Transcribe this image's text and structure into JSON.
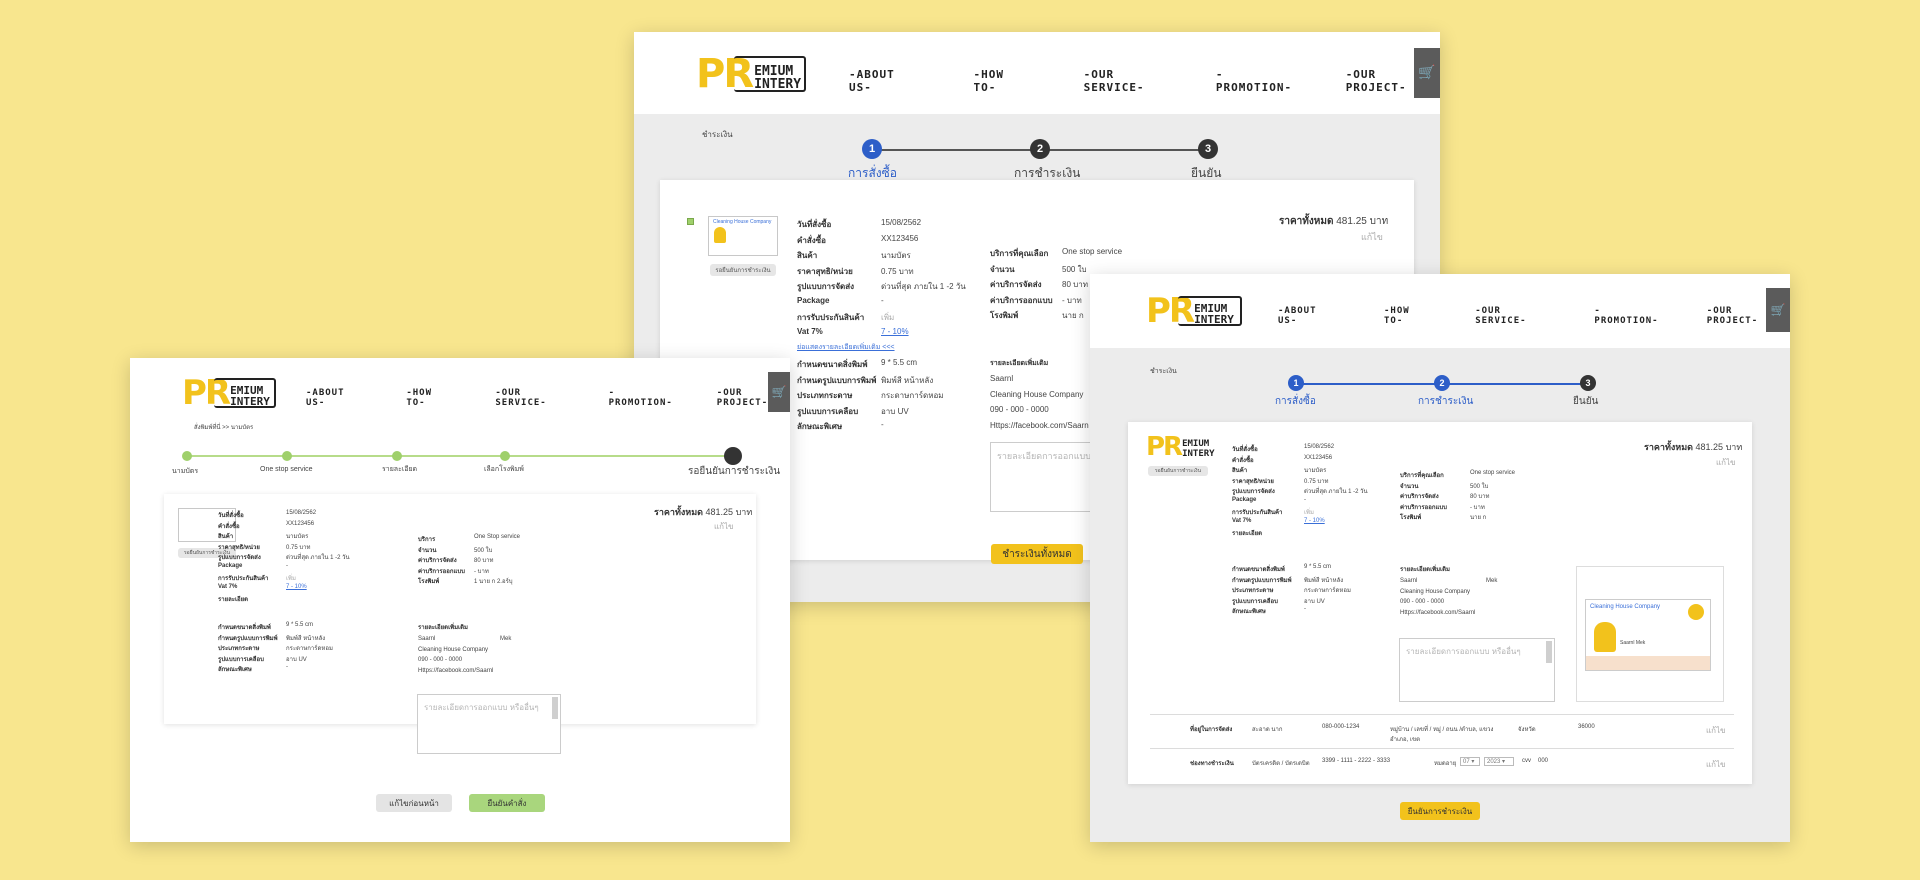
{
  "brand": {
    "logo_pr": "PR",
    "logo_top": "EMIUM",
    "logo_bottom": "INTERY"
  },
  "nav": [
    "-ABOUT US-",
    "-HOW TO-",
    "-OUR SERVICE-",
    "-PROMOTION-",
    "-OUR PROJECT-"
  ],
  "icons": {
    "cart": "shopping-cart-icon"
  },
  "colors": {
    "bg": "#f8e68e",
    "brand_yellow": "#f2c21c",
    "step_blue": "#2d5ec8",
    "green": "#9fd06b"
  },
  "center": {
    "breadcrumb": "ชำระเงิน",
    "steps": [
      "การสั่งซื้อ",
      "การชำระเงิน",
      "ยืนยัน"
    ],
    "step_nums": [
      "1",
      "2",
      "3"
    ],
    "status_btn": "รอยืนยันการชำระเงิน",
    "total_label": "ราคาทั้งหมด",
    "total_value": "481.25",
    "total_unit": "บาท",
    "edit": "แก้ไข",
    "left_rows": [
      {
        "label": "วันที่สั่งซื้อ",
        "value": "15/08/2562"
      },
      {
        "label": "คำสั่งซื้อ",
        "value": "XX123456"
      },
      {
        "label": "สินค้า",
        "value": "นามบัตร"
      },
      {
        "label": "ราคาสุทธิ/หน่วย",
        "value": "0.75 บาท"
      },
      {
        "label": "รูปแบบการจัดส่ง",
        "value": "ด่วนที่สุด ภายใน 1 -2 วัน"
      },
      {
        "label": "Package",
        "value": "-"
      },
      {
        "label": "การรับประกันสินค้า",
        "value": "เพิ่ม"
      },
      {
        "label": "Vat 7%",
        "value": "7 - 10%"
      }
    ],
    "right_rows": [
      {
        "label": "บริการที่คุณเลือก",
        "value": "One stop service"
      },
      {
        "label": "จำนวน",
        "value": "500 ใบ"
      },
      {
        "label": "ค่าบริการจัดส่ง",
        "value": "80 บาท"
      },
      {
        "label": "ค่าบริการออกแบบ",
        "value": "- บาท"
      },
      {
        "label": "โรงพิมพ์",
        "value": "นาย ก"
      }
    ],
    "more_link": "ย่อแสดงรายละเอียดเพิ่มเติม <<<",
    "spec_rows": [
      {
        "label": "กำหนดขนาดสิ่งพิมพ์",
        "value": "9 * 5.5 cm"
      },
      {
        "label": "กำหนดรูปแบบการพิมพ์",
        "value": "พิมพ์สี หน้าหลัง"
      },
      {
        "label": "ประเภทกระดาษ",
        "value": "กระดาษการ์ดหอม"
      },
      {
        "label": "รูปแบบการเคลือบ",
        "value": "อาบ UV"
      },
      {
        "label": "ลักษณะพิเศษ",
        "value": "-"
      }
    ],
    "extra_title": "รายละเอียดเพิ่มเติม",
    "extra_lines": [
      "Saarnl",
      "Cleaning House Company",
      "090 - 000 - 0000",
      "Https://facebook.com/Saarn"
    ],
    "textarea_ph": "รายละเอียดการออกแบบ",
    "pay_btn": "ชำระเงินทั้งหมด"
  },
  "left": {
    "breadcrumb": "สั่งพิมพ์ที่นี่ >> นามบัตร",
    "progress": [
      "นามบัตร",
      "One stop service",
      "รายละเอียด",
      "เลือกโรงพิมพ์",
      "รอยืนยันการชำระเงิน"
    ],
    "status_btn": "รอยืนยันการชำระเงิน",
    "total_label": "ราคาทั้งหมด",
    "total_value": "481.25",
    "total_unit": "บาท",
    "edit": "แก้ไข",
    "left_rows": [
      {
        "label": "วันที่สั่งซื้อ",
        "value": "15/08/2562"
      },
      {
        "label": "คำสั่งซื้อ",
        "value": "XX123456"
      },
      {
        "label": "สินค้า",
        "value": "นามบัตร"
      },
      {
        "label": "ราคาสุทธิ/หน่วย",
        "value": "0.75 บาท"
      },
      {
        "label": "รูปแบบการจัดส่ง",
        "value": "ด่วนที่สุด ภายใน 1 -2 วัน"
      },
      {
        "label": "Package",
        "value": "-"
      },
      {
        "label": "การรับประกันสินค้า",
        "value": "เพิ่ม"
      },
      {
        "label": "Vat 7%",
        "value": "7 - 10%"
      },
      {
        "label": "รายละเอียด",
        "value": ""
      }
    ],
    "right_rows": [
      {
        "label": "บริการ",
        "value": "One Stop service"
      },
      {
        "label": "จำนวน",
        "value": "500 ใบ"
      },
      {
        "label": "ค่าบริการจัดส่ง",
        "value": "80 บาท"
      },
      {
        "label": "ค่าบริการออกแบบ",
        "value": "- บาท"
      },
      {
        "label": "โรงพิมพ์",
        "value": "1 นาย ก  2.อร์บุ"
      }
    ],
    "spec_rows": [
      {
        "label": "กำหนดขนาดสิ่งพิมพ์",
        "value": "9 * 5.5 cm"
      },
      {
        "label": "กำหนดรูปแบบการพิมพ์",
        "value": "พิมพ์สี หน้าหลัง"
      },
      {
        "label": "ประเภทกระดาษ",
        "value": "กระดาษการ์ดหอม"
      },
      {
        "label": "รูปแบบการเคลือบ",
        "value": "อาบ UV"
      },
      {
        "label": "ลักษณะพิเศษ",
        "value": "-"
      }
    ],
    "extra_title": "รายละเอียดเพิ่มเติม",
    "extra_lines": [
      "Saarnl",
      "Cleaning House Company",
      "090 - 000 - 0000",
      "Https://facebook.com/Saarnl"
    ],
    "extra_side": "Mek",
    "textarea_ph": "รายละเอียดการออกแบบ หรืออื่นๆ",
    "back_btn": "แก้ไขก่อนหน้า",
    "confirm_btn": "ยืนยันคำสั่ง"
  },
  "right": {
    "breadcrumb": "ชำระเงิน",
    "steps": [
      "การสั่งซื้อ",
      "การชำระเงิน",
      "ยืนยัน"
    ],
    "step_nums": [
      "1",
      "2",
      "3"
    ],
    "status_btn": "รอยืนยันการชำระเงิน",
    "total_label": "ราคาทั้งหมด",
    "total_value": "481.25",
    "total_unit": "บาท",
    "edit": "แก้ไข",
    "left_rows": [
      {
        "label": "วันที่สั่งซื้อ",
        "value": "15/08/2562"
      },
      {
        "label": "คำสั่งซื้อ",
        "value": "XX123456"
      },
      {
        "label": "สินค้า",
        "value": "นามบัตร"
      },
      {
        "label": "ราคาสุทธิ/หน่วย",
        "value": "0.75 บาท"
      },
      {
        "label": "รูปแบบการจัดส่ง",
        "value": "ด่วนที่สุด ภายใน 1 -2 วัน"
      },
      {
        "label": "Package",
        "value": "-"
      },
      {
        "label": "การรับประกันสินค้า",
        "value": "เพิ่ม"
      },
      {
        "label": "Vat 7%",
        "value": "7 - 10%"
      },
      {
        "label": "รายละเอียด",
        "value": ""
      }
    ],
    "right_rows": [
      {
        "label": "บริการที่คุณเลือก",
        "value": "One stop service"
      },
      {
        "label": "จำนวน",
        "value": "500 ใบ"
      },
      {
        "label": "ค่าบริการจัดส่ง",
        "value": "80 บาท"
      },
      {
        "label": "ค่าบริการออกแบบ",
        "value": "- บาท"
      },
      {
        "label": "โรงพิมพ์",
        "value": "นาย ก"
      }
    ],
    "spec_rows": [
      {
        "label": "กำหนดขนาดสิ่งพิมพ์",
        "value": "9 * 5.5 cm"
      },
      {
        "label": "กำหนดรูปแบบการพิมพ์",
        "value": "พิมพ์สี หน้าหลัง"
      },
      {
        "label": "ประเภทกระดาษ",
        "value": "กระดาษการ์ดหอม"
      },
      {
        "label": "รูปแบบการเคลือบ",
        "value": "อาบ UV"
      },
      {
        "label": "ลักษณะพิเศษ",
        "value": "-"
      }
    ],
    "extra_title": "รายละเอียดเพิ่มเติม",
    "extra_lines": [
      "Saarnl",
      "Cleaning House Company",
      "090 - 000 - 0000",
      "Https://facebook.com/Saarnl"
    ],
    "extra_side": "Mek",
    "textarea_ph": "รายละเอียดการออกแบบ หรืออื่นๆ",
    "preview_company": "Cleaning House Company",
    "preview_name": "Saarnl Mek",
    "addr_label": "ที่อยู่ในการจัดส่ง",
    "addr_name": "สะอาด นาก",
    "addr_phone": "080-000-1234",
    "addr_line1": "หมู่บ้าน / เลขที่ / หมู่ / ถนน /ตำบล, แขวง",
    "addr_line2": "อำเภอ, เขต",
    "addr_prov": "จังหวัด",
    "addr_zip": "36000",
    "addr_edit": "แก้ไข",
    "pay_label": "ช่องทางชำระเงิน",
    "pay_type": "บัตรเครดิต / บัตรเดบิต",
    "pay_card": "3399 - 1111 - 2222 - 3333",
    "exp_label": "หมดอายุ",
    "exp_month": "07",
    "exp_year": "2023",
    "cvv_label": "cvv",
    "cvv": "000",
    "pay_edit": "แก้ไข",
    "confirm_btn": "ยืนยันการชำระเงิน"
  }
}
